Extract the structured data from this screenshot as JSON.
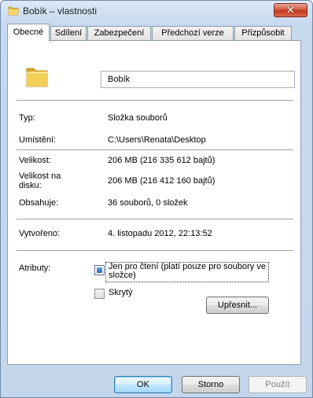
{
  "window": {
    "title": "Bobík – vlastnosti",
    "close_label": "✕"
  },
  "tabs": [
    {
      "label": "Obecné",
      "active": true
    },
    {
      "label": "Sdílení"
    },
    {
      "label": "Zabezpečení"
    },
    {
      "label": "Předchozí verze"
    },
    {
      "label": "Přizpůsobit"
    }
  ],
  "general": {
    "name_value": "Bobík",
    "type": {
      "label": "Typ:",
      "value": "Složka souborů"
    },
    "location": {
      "label": "Umístění:",
      "value": "C:\\Users\\Renata\\Desktop"
    },
    "size": {
      "label": "Velikost:",
      "value": "206 MB (216 335 612 bajtů)"
    },
    "size_on_disk": {
      "label": "Velikost na disku:",
      "value": "206 MB (216 412 160 bajtů)"
    },
    "contains": {
      "label": "Obsahuje:",
      "value": "36 souborů, 0 složek"
    },
    "created": {
      "label": "Vytvořeno:",
      "value": "4. listopadu 2012, 22:13:52"
    },
    "attributes": {
      "label": "Atributy:",
      "readonly_label": "Jen pro čtení (platí pouze pro soubory ve složce)",
      "readonly_state": "indeterminate",
      "hidden_label": "Skrytý",
      "hidden_checked": false,
      "advanced_label": "Upřesnit..."
    }
  },
  "buttons": {
    "ok": "OK",
    "cancel": "Storno",
    "apply": "Použít"
  },
  "icons": {
    "title": "folder-icon",
    "big": "folder-icon",
    "close": "close-icon"
  }
}
